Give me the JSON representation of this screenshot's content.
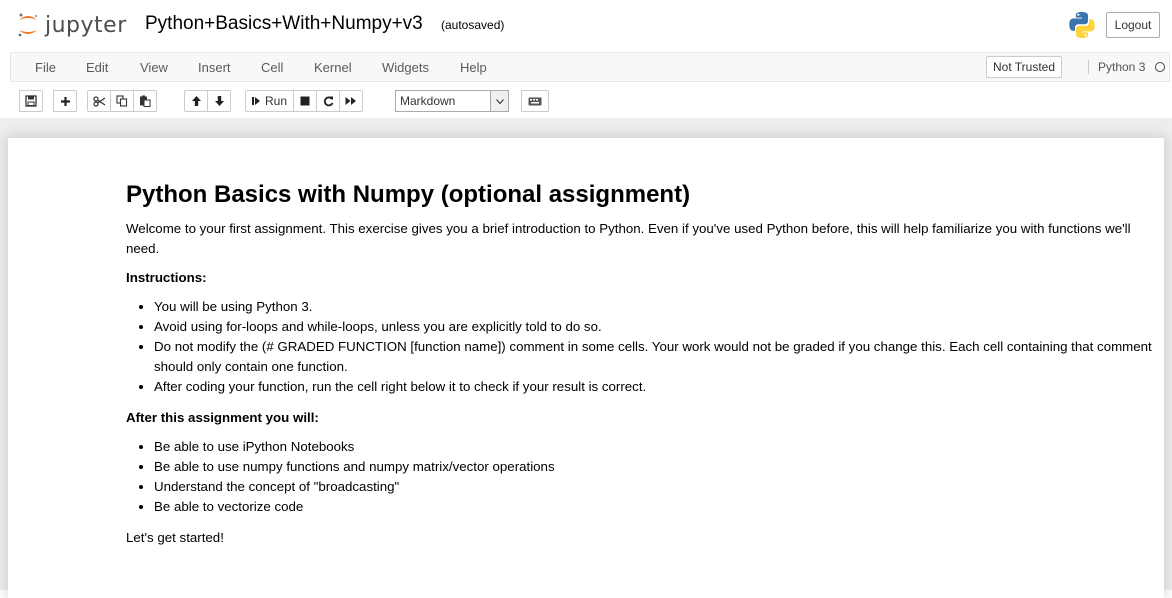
{
  "header": {
    "logo_text": "jupyter",
    "notebook_name": "Python+Basics+With+Numpy+v3",
    "autosave_status": "(autosaved)",
    "logout_label": "Logout"
  },
  "menubar": {
    "items": [
      "File",
      "Edit",
      "View",
      "Insert",
      "Cell",
      "Kernel",
      "Widgets",
      "Help"
    ],
    "trust_status": "Not Trusted",
    "kernel_name": "Python 3"
  },
  "toolbar": {
    "icons": [
      "save-icon",
      "plus-icon",
      "cut-icon",
      "copy-icon",
      "paste-icon",
      "arrow-up-icon",
      "arrow-down-icon",
      "run-icon",
      "stop-icon",
      "restart-icon",
      "fast-forward-icon",
      "keyboard-icon"
    ],
    "run_label": "Run",
    "cell_type": "Markdown"
  },
  "content": {
    "title": "Python Basics with Numpy (optional assignment)",
    "intro": "Welcome to your first assignment. This exercise gives you a brief introduction to Python. Even if you've used Python before, this will help familiarize you with functions we'll need.",
    "instructions_heading": "Instructions:",
    "instructions": [
      "You will be using Python 3.",
      "Avoid using for-loops and while-loops, unless you are explicitly told to do so.",
      "Do not modify the (# GRADED FUNCTION [function name]) comment in some cells. Your work would not be graded if you change this. Each cell containing that comment should only contain one function.",
      "After coding your function, run the cell right below it to check if your result is correct."
    ],
    "after_heading": "After this assignment you will:",
    "outcomes": [
      "Be able to use iPython Notebooks",
      "Be able to use numpy functions and numpy matrix/vector operations",
      "Understand the concept of \"broadcasting\"",
      "Be able to vectorize code"
    ],
    "closing": "Let's get started!"
  }
}
